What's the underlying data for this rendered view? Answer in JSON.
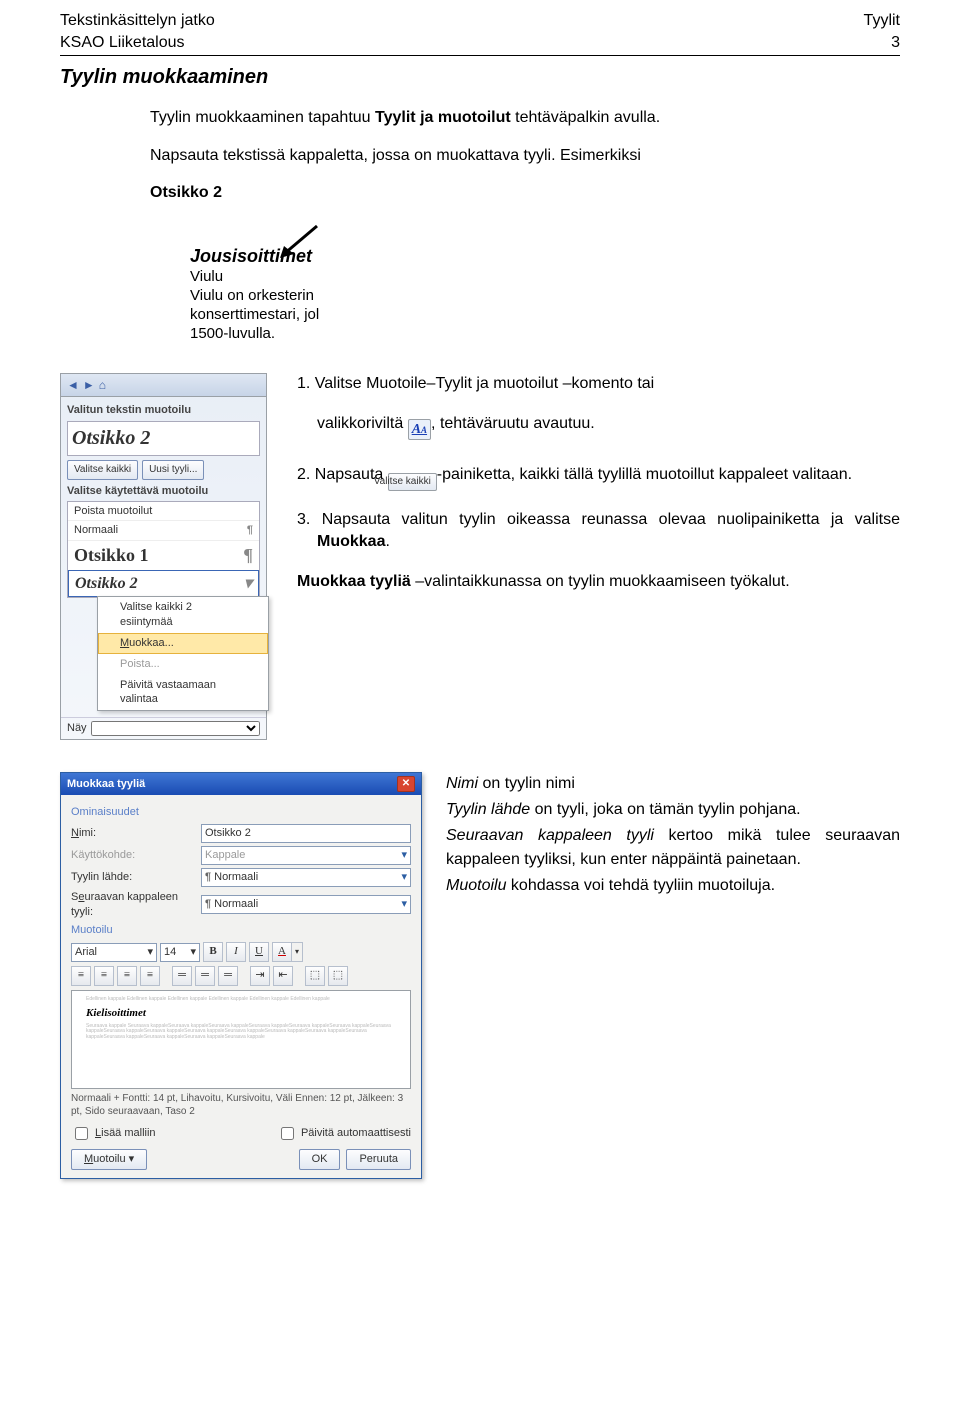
{
  "header": {
    "left1": "Tekstinkäsittelyn jatko",
    "left2": "KSAO Liiketalous",
    "right1": "Tyylit",
    "right2": "3"
  },
  "section_title": "Tyylin muokkaaminen",
  "intro": {
    "l1a": "Tyylin muokkaaminen tapahtuu ",
    "l1b": "Tyylit ja muotoilut",
    "l1c": " tehtäväpalkin avulla.",
    "l2": "Napsauta tekstissä kappaletta, jossa on muokattava tyyli. Esimerkiksi",
    "l3": "Otsikko 2"
  },
  "doc_sample": {
    "h2": "Jousisoittimet",
    "lines": "Viulu\nViulu on orkesterin\nkonserttimestari, jol\n1500-luvulla."
  },
  "taskpane": {
    "lbl_sel": "Valitun tekstin muotoilu",
    "big": "Otsikko 2",
    "btn_all": "Valitse kaikki",
    "btn_new": "Uusi tyyli...",
    "lbl_pick": "Valitse käytettävä muotoilu",
    "items": {
      "clear": "Poista muotoilut",
      "normal": "Normaali",
      "h1": "Otsikko 1",
      "h2": "Otsikko 2"
    },
    "ctx": {
      "i1": "Valitse kaikki 2 esiintymää",
      "i2": "Muokkaa...",
      "i3": "Poista...",
      "i4": "Päivitä vastaamaan valintaa"
    },
    "foot_label": "Näy"
  },
  "steps": {
    "s1a": "1. Valitse Muotoile–Tyylit ja muotoilut –komento tai",
    "s1b_pre": "valikkoriviltä ",
    "s1b_post": ", tehtäväruutu avautuu.",
    "s2a": "2. Napsauta ",
    "s2b": "Valitse kaikki",
    "s2c": "-painiketta, kaikki tällä tyylillä muotoillut kappaleet valitaan.",
    "s3": "3. Napsauta valitun tyylin oikeassa reunassa olevaa nuolipainiketta ja valitse ",
    "s3b": "Muokkaa",
    "s3c": ".",
    "fin_a": "Muokkaa tyyliä ",
    "fin_b": "–valintaikkunassa on tyylin muokkaamiseen työkalut."
  },
  "dialog": {
    "title": "Muokkaa tyyliä",
    "g1": "Ominaisuudet",
    "r1": {
      "lab": "Nimi:",
      "val": "Otsikko 2"
    },
    "r2": {
      "lab": "Käyttökohde:",
      "val": "Kappale"
    },
    "r3": {
      "lab": "Tyylin lähde:",
      "val": "Normaali"
    },
    "r4": {
      "lab": "Seuraavan kappaleen tyyli:",
      "val": "Normaali"
    },
    "g2": "Muotoilu",
    "font": "Arial",
    "size": "14",
    "preview_heading": "Kielisoittimet",
    "desc": "Normaali + Fontti: 14 pt, Lihavoitu, Kursivoitu, Väli Ennen:  12 pt, Jälkeen:  3 pt, Sido seuraavaan, Taso 2",
    "chk1": "Lisää malliin",
    "chk2": "Päivitä automaattisesti",
    "btn_fmt": "Muotoilu",
    "btn_ok": "OK",
    "btn_cancel": "Peruuta"
  },
  "notes": {
    "n1a": "Nimi",
    "n1b": " on tyylin nimi",
    "n2a": "Tyylin lähde",
    "n2b": " on tyyli, joka on tämän tyylin pohjana.",
    "n3a": "Seuraavan kappaleen tyyli",
    "n3b": " kertoo mikä tulee seuraavan kappaleen tyyliksi, kun enter näppäintä painetaan.",
    "n4a": "Muotoilu",
    "n4b": " kohdassa voi tehdä tyyliin muotoiluja."
  },
  "icons": {
    "aa": "A"
  }
}
